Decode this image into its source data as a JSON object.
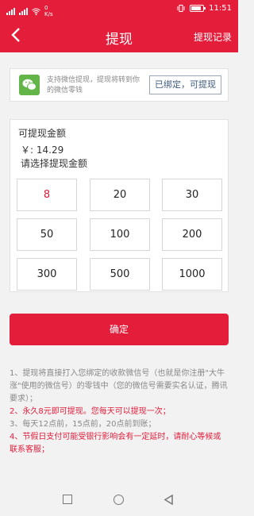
{
  "status": {
    "network_speed": "0",
    "network_unit": "K/s",
    "battery_level": 0.6,
    "time": "11:51"
  },
  "header": {
    "back_icon": "chevron-left-icon",
    "title": "提现",
    "right_link": "提现记录"
  },
  "binding": {
    "icon": "wechat-logo-icon",
    "description": "支持微信提现，提现将转到你的微信零钱",
    "status_button": "已绑定，可提现"
  },
  "amount": {
    "label": "可提现金额",
    "value": "￥: 14.29",
    "choose_prompt": "请选择提现金额",
    "options": [
      "8",
      "20",
      "30",
      "50",
      "100",
      "200",
      "300",
      "500",
      "1000"
    ],
    "selected": "8"
  },
  "confirm_button": "确定",
  "notes": [
    "1、提现将直接打入您绑定的收款微信号（也就是你注册\"大牛涨\"使用的微信号）的零钱中（您的微信号需要实名认证，腾讯要求）；",
    "2、永久8元即可提现。您每天可以提现一次；",
    "3、每天12点前，15点前，20点前到账；",
    "4、节假日支付可能受银行影响会有一定延时，请耐心等候或联系客服；"
  ],
  "colors": {
    "brand_red": "#e41d3b",
    "wechat_green": "#63b54a",
    "note_gray": "#888888"
  },
  "system_nav": {
    "recents_icon": "square-icon",
    "home_icon": "circle-icon",
    "back_icon": "triangle-back-icon"
  }
}
